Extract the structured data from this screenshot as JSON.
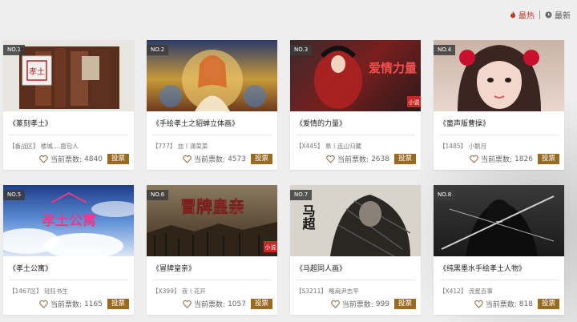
{
  "sort": {
    "hot_label": "最热",
    "new_label": "最新",
    "hot_color": "#c0392b"
  },
  "vote_count_prefix": "当前票数:",
  "vote_button_label": "投票",
  "cards": [
    {
      "no": "NO.1",
      "title": "《篆刻孝土》",
      "meta": "【备战区】 楼城....面包人",
      "votes": "4840",
      "art": "seal"
    },
    {
      "no": "NO.2",
      "title": "《手绘孝土之貂蝉立体画》",
      "meta": "【777】 血丨潇菜菜",
      "votes": "4573",
      "art": "diaochan"
    },
    {
      "no": "NO.3",
      "title": "《爱情的力量》",
      "meta": "【X445】 易丨连山归藏",
      "votes": "2638",
      "art": "love"
    },
    {
      "no": "NO.4",
      "title": "《童声版曹操》",
      "meta": "【1485】 小鹅月",
      "votes": "1826",
      "art": "portrait"
    },
    {
      "no": "NO.5",
      "title": "《孝土公寓》",
      "meta": "【1467区】 轻狂书生",
      "votes": "1165",
      "art": "sky"
    },
    {
      "no": "NO.6",
      "title": "《冒牌皇亲》",
      "meta": "【X399】 夜丨花开",
      "votes": "1057",
      "art": "battle"
    },
    {
      "no": "NO.7",
      "title": "《马超同人画》",
      "meta": "【S3211】 略肩尹志平",
      "votes": "999",
      "art": "machao"
    },
    {
      "no": "NO.8",
      "title": "《纯黑墨水手绘孝土人物》",
      "meta": "【X412】 流星百事",
      "votes": "818",
      "art": "ink"
    }
  ],
  "art_text": {
    "seal": "孝土",
    "love": "爱情力量",
    "sky": "孝土公寓",
    "battle": "冒牌皇亲",
    "machao": "马超",
    "xiaoshuo": "小说"
  }
}
